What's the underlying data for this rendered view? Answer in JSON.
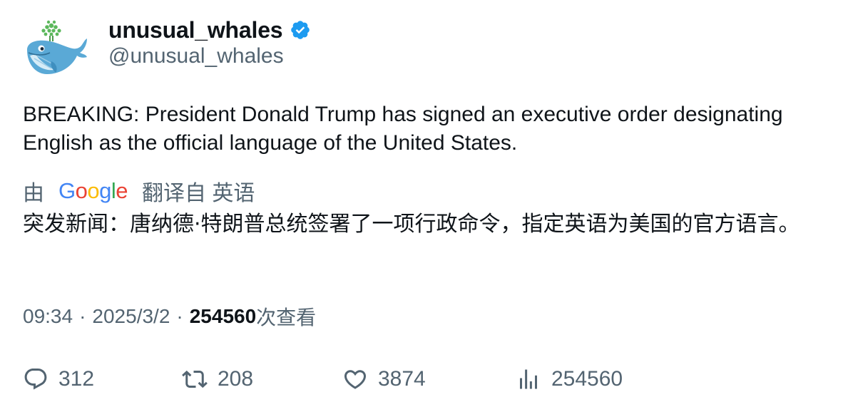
{
  "author": {
    "display_name": "unusual_whales",
    "handle": "@unusual_whales",
    "verified": true,
    "avatar_icon": "whale-avatar",
    "badge_color": "#1d9bf0"
  },
  "tweet": {
    "text_en": "BREAKING: President Donald Trump has signed an executive order designating English as the official language of the United States.",
    "translation": {
      "prefix": "由",
      "provider": "Google",
      "suffix": "翻译自 英语",
      "text": "突发新闻：唐纳德·特朗普总统签署了一项行政命令，指定英语为美国的官方语言。"
    },
    "time": "09:34",
    "separator": "·",
    "date": "2025/3/2",
    "views_count": "254560",
    "views_label": "次查看"
  },
  "actions": {
    "reply": {
      "icon": "reply-icon",
      "count": "312"
    },
    "retweet": {
      "icon": "retweet-icon",
      "count": "208"
    },
    "like": {
      "icon": "heart-icon",
      "count": "3874"
    },
    "views": {
      "icon": "analytics-icon",
      "count": "254560"
    }
  },
  "colors": {
    "text_primary": "#0f1419",
    "text_secondary": "#536471",
    "verified_blue": "#1d9bf0"
  }
}
